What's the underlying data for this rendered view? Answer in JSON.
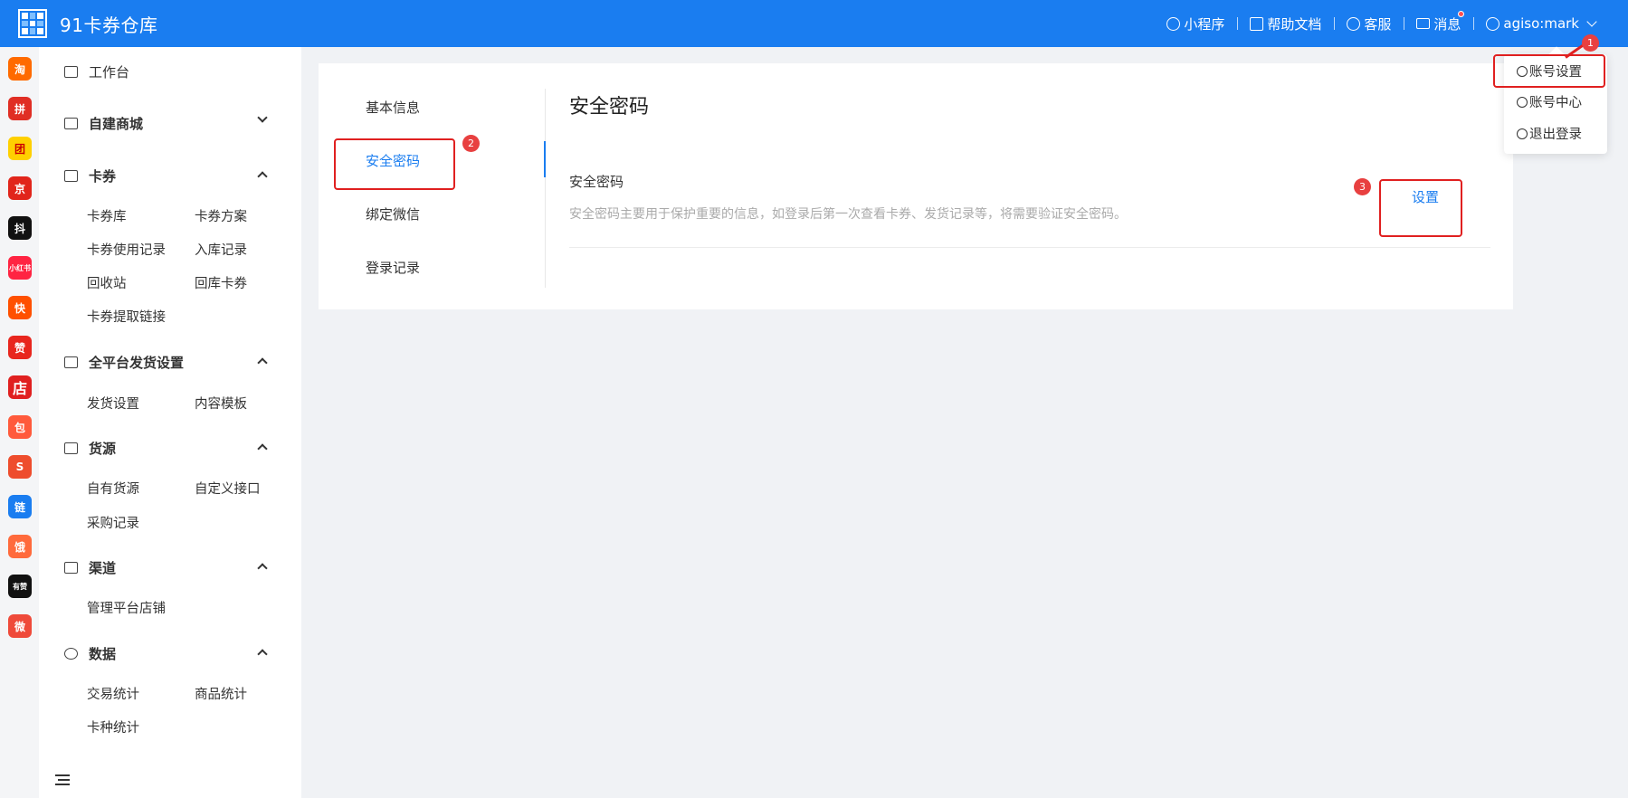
{
  "header": {
    "app_title": "91卡券仓库",
    "nav": [
      "小程序",
      "帮助文档",
      "客服",
      "消息"
    ],
    "username": "agiso:mark",
    "brand_color": "#1a7df0"
  },
  "platforms": [
    {
      "name": "taobao",
      "label": "淘",
      "color": "#ff6a00"
    },
    {
      "name": "pinduoduo",
      "label": "拼",
      "color": "#e02e24"
    },
    {
      "name": "meituan-tuangou",
      "label": "团",
      "color": "#ffd000"
    },
    {
      "name": "jd",
      "label": "京",
      "color": "#e1251b"
    },
    {
      "name": "douyin",
      "label": "抖",
      "color": "#111111"
    },
    {
      "name": "xiaohongshu",
      "label": "小红书",
      "color": "#ff2442"
    },
    {
      "name": "kuaishou",
      "label": "快",
      "color": "#ff5000"
    },
    {
      "name": "dianzan",
      "label": "赞",
      "color": "#e8261e"
    },
    {
      "name": "dian",
      "label": "店",
      "color": "#e02020"
    },
    {
      "name": "bag-shop",
      "label": "包",
      "color": "#ff5a3c"
    },
    {
      "name": "shopee",
      "label": "S",
      "color": "#ee4d2d"
    },
    {
      "name": "link",
      "label": "链",
      "color": "#1a7df0"
    },
    {
      "name": "ele",
      "label": "饿",
      "color": "#ff6a3c"
    },
    {
      "name": "youzan",
      "label": "有赞",
      "color": "#111111"
    },
    {
      "name": "weidian",
      "label": "微",
      "color": "#ef4a3a"
    }
  ],
  "sidebar": {
    "workbench": "工作台",
    "groups": [
      {
        "label": "自建商城",
        "expanded": false,
        "items": []
      },
      {
        "label": "卡券",
        "expanded": true,
        "items": [
          "卡券库",
          "卡券方案",
          "卡券使用记录",
          "入库记录",
          "回收站",
          "回库卡券",
          "卡券提取链接"
        ]
      },
      {
        "label": "全平台发货设置",
        "expanded": true,
        "items": [
          "发货设置",
          "内容模板"
        ]
      },
      {
        "label": "货源",
        "expanded": true,
        "items": [
          "自有货源",
          "自定义接口",
          "采购记录"
        ]
      },
      {
        "label": "渠道",
        "expanded": true,
        "items": [
          "管理平台店铺"
        ]
      },
      {
        "label": "数据",
        "expanded": true,
        "items": [
          "交易统计",
          "商品统计",
          "卡种统计"
        ]
      }
    ]
  },
  "tabs": [
    "基本信息",
    "安全密码",
    "绑定微信",
    "登录记录"
  ],
  "active_tab": "安全密码",
  "section": {
    "title": "安全密码",
    "field_label": "安全密码",
    "field_desc": "安全密码主要用于保护重要的信息，如登录后第一次查看卡券、发货记录等，将需要验证安全密码。",
    "action": "设置"
  },
  "dropdown": [
    "账号设置",
    "账号中心",
    "退出登录"
  ],
  "annotations": [
    "1",
    "2",
    "3"
  ]
}
